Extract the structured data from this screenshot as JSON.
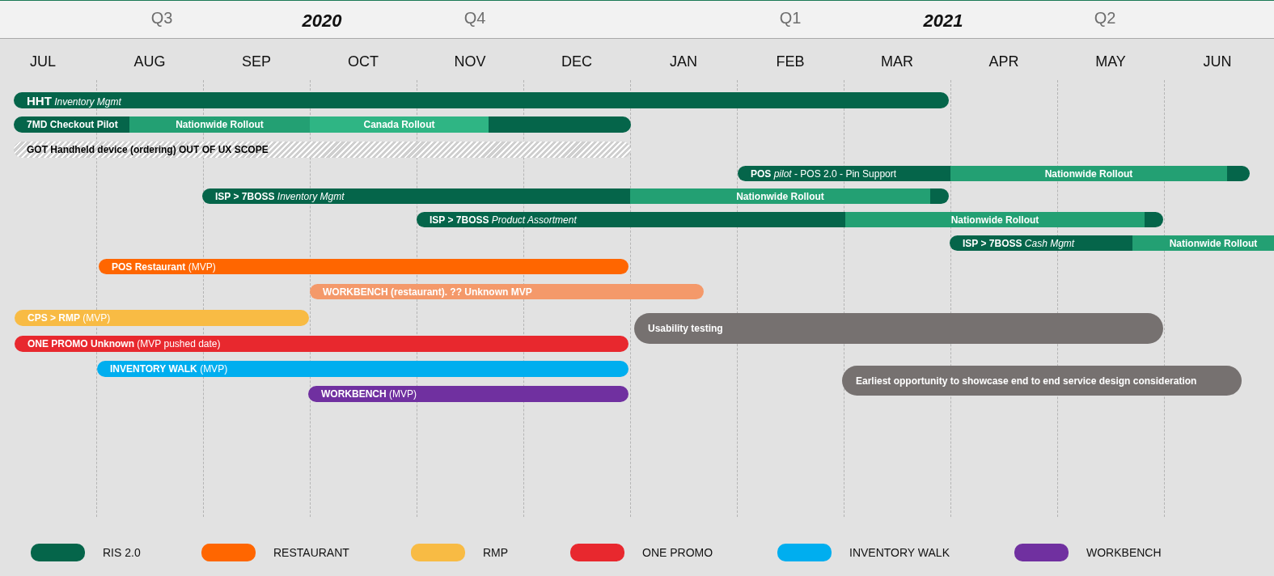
{
  "header": {
    "top_labels": [
      {
        "kind": "quarter",
        "label": "Q3"
      },
      {
        "kind": "year",
        "label": "2020"
      },
      {
        "kind": "quarter",
        "label": "Q4"
      },
      {
        "kind": "quarter",
        "label": "Q1"
      },
      {
        "kind": "year",
        "label": "2021"
      },
      {
        "kind": "quarter",
        "label": "Q2"
      }
    ],
    "months": [
      "JUL",
      "AUG",
      "SEP",
      "OCT",
      "NOV",
      "DEC",
      "JAN",
      "FEB",
      "MAR",
      "APR",
      "MAY",
      "JUN"
    ]
  },
  "bars": [
    {
      "kind": "segmented",
      "segments": [
        {
          "label": "**HHT** *Inventory Mgmt*",
          "color": "#05654a"
        }
      ]
    },
    {
      "kind": "segmented",
      "segments": [
        {
          "label": "**7MD Checkout Pilot**",
          "color": "#05654a"
        },
        {
          "label": "**Nationwide  Rollout**",
          "color": "#23a073"
        },
        {
          "label": "**Canada Rollout**",
          "color": "#2fb584"
        },
        {
          "color": "#05654a"
        }
      ]
    },
    {
      "kind": "hatched",
      "segments": [
        {
          "label": "**GOT Handheld device (ordering) OUT OF UX SCOPE**"
        }
      ]
    },
    {
      "kind": "segmented",
      "segments": [
        {
          "label": "**POS** *pilot* - POS 2.0 - Pin Support",
          "color": "#05654a"
        },
        {
          "label": "**Nationwide Rollout**",
          "color": "#23a073"
        },
        {
          "color": "#05654a"
        }
      ]
    },
    {
      "kind": "segmented",
      "segments": [
        {
          "label": "**ISP > 7BOSS** *Inventory Mgmt*",
          "color": "#05654a"
        },
        {
          "label": "**Nationwide Rollout**",
          "color": "#23a073"
        },
        {
          "color": "#05654a"
        }
      ]
    },
    {
      "kind": "segmented",
      "segments": [
        {
          "label": "**ISP > 7BOSS** *Product Assortment*",
          "color": "#05654a"
        },
        {
          "label": "**Nationwide Rollout**",
          "color": "#23a073"
        },
        {
          "color": "#05654a"
        }
      ]
    },
    {
      "kind": "segmented",
      "segments": [
        {
          "label": "**ISP > 7BOSS** *Cash Mgmt*",
          "color": "#05654a"
        },
        {
          "label": "**Nationwide Rollout**",
          "color": "#23a073"
        }
      ]
    },
    {
      "kind": "segmented",
      "segments": [
        {
          "label": "**POS Restaurant** (MVP)",
          "color": "#ff6600"
        }
      ]
    },
    {
      "kind": "segmented",
      "segments": [
        {
          "label": "**WORKBENCH (restaurant). ?? Unknown MVP**",
          "color": "#f4996a"
        }
      ]
    },
    {
      "kind": "segmented",
      "segments": [
        {
          "label": "**CPS > RMP** (MVP)",
          "color": "#f8bb44"
        }
      ]
    },
    {
      "kind": "segmented",
      "segments": [
        {
          "label": "**ONE PROMO Unknown** (MVP pushed date)",
          "color": "#e8282e"
        }
      ]
    },
    {
      "kind": "segmented",
      "segments": [
        {
          "label": "**INVENTORY WALK** (MVP)",
          "color": "#00aeef"
        }
      ]
    },
    {
      "kind": "segmented",
      "segments": [
        {
          "label": "**WORKBENCH** (MVP)",
          "color": "#7030a0"
        }
      ]
    },
    {
      "kind": "note",
      "segments": [
        {
          "label": "Usability testing",
          "color": "#767170"
        }
      ]
    },
    {
      "kind": "note",
      "segments": [
        {
          "label": "Earliest opportunity to showcase end to end service design consideration",
          "color": "#767170"
        }
      ]
    }
  ],
  "legend": [
    {
      "label": "RIS 2.0",
      "color": "#05654a"
    },
    {
      "label": "RESTAURANT",
      "color": "#ff6600"
    },
    {
      "label": "RMP",
      "color": "#f8bb44"
    },
    {
      "label": "ONE PROMO",
      "color": "#e8282e"
    },
    {
      "label": "INVENTORY WALK",
      "color": "#00aeef"
    },
    {
      "label": "WORKBENCH",
      "color": "#7030a0"
    }
  ]
}
